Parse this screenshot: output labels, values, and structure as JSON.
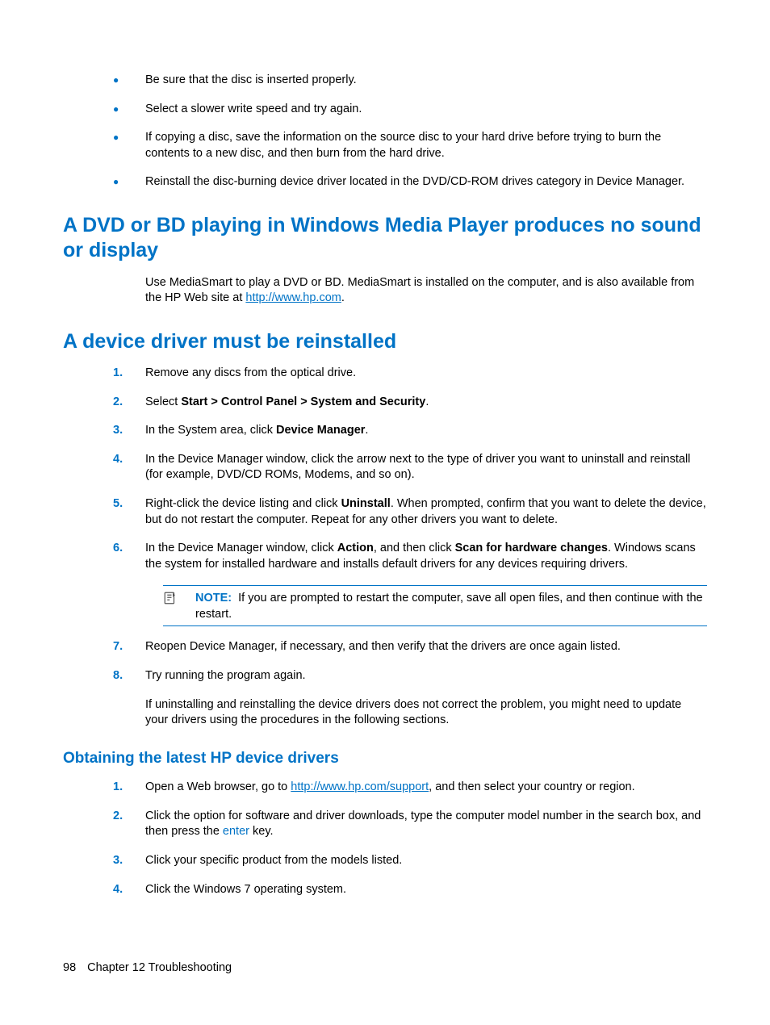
{
  "bullets": [
    "Be sure that the disc is inserted properly.",
    "Select a slower write speed and try again.",
    "If copying a disc, save the information on the source disc to your hard drive before trying to burn the contents to a new disc, and then burn from the hard drive.",
    "Reinstall the disc-burning device driver located in the DVD/CD-ROM drives category in Device Manager."
  ],
  "heading1": "A DVD or BD playing in Windows Media Player produces no sound or display",
  "para1_pre": "Use MediaSmart to play a DVD or BD. MediaSmart is installed on the computer, and is also available from the HP Web site at ",
  "para1_link": "http://www.hp.com",
  "para1_post": ".",
  "heading2": "A device driver must be reinstalled",
  "steps": {
    "s1": {
      "num": "1.",
      "text": "Remove any discs from the optical drive."
    },
    "s2": {
      "num": "2.",
      "pre": "Select ",
      "bold": "Start > Control Panel > System and Security",
      "post": "."
    },
    "s3": {
      "num": "3.",
      "pre": "In the System area, click ",
      "bold": "Device Manager",
      "post": "."
    },
    "s4": {
      "num": "4.",
      "text": "In the Device Manager window, click the arrow next to the type of driver you want to uninstall and reinstall (for example, DVD/CD ROMs, Modems, and so on)."
    },
    "s5": {
      "num": "5.",
      "pre": "Right-click the device listing and click ",
      "bold": "Uninstall",
      "post": ". When prompted, confirm that you want to delete the device, but do not restart the computer. Repeat for any other drivers you want to delete."
    },
    "s6": {
      "num": "6.",
      "pre": "In the Device Manager window, click ",
      "bold1": "Action",
      "mid": ", and then click ",
      "bold2": "Scan for hardware changes",
      "post": ". Windows scans the system for installed hardware and installs default drivers for any devices requiring drivers."
    },
    "s7": {
      "num": "7.",
      "text": "Reopen Device Manager, if necessary, and then verify that the drivers are once again listed."
    },
    "s8": {
      "num": "8.",
      "text": "Try running the program again."
    }
  },
  "note": {
    "label": "NOTE:",
    "text": "If you are prompted to restart the computer, save all open files, and then continue with the restart."
  },
  "para2": "If uninstalling and reinstalling the device drivers does not correct the problem, you might need to update your drivers using the procedures in the following sections.",
  "heading3": "Obtaining the latest HP device drivers",
  "steps2": {
    "s1": {
      "num": "1.",
      "pre": "Open a Web browser, go to ",
      "link": "http://www.hp.com/support",
      "post": ", and then select your country or region."
    },
    "s2": {
      "num": "2.",
      "pre": "Click the option for software and driver downloads, type the computer model number in the search box, and then press the ",
      "key": "enter",
      "post": " key."
    },
    "s3": {
      "num": "3.",
      "text": "Click your specific product from the models listed."
    },
    "s4": {
      "num": "4.",
      "text": "Click the Windows 7 operating system."
    }
  },
  "footer": {
    "page": "98",
    "chapter": "Chapter 12   Troubleshooting"
  }
}
